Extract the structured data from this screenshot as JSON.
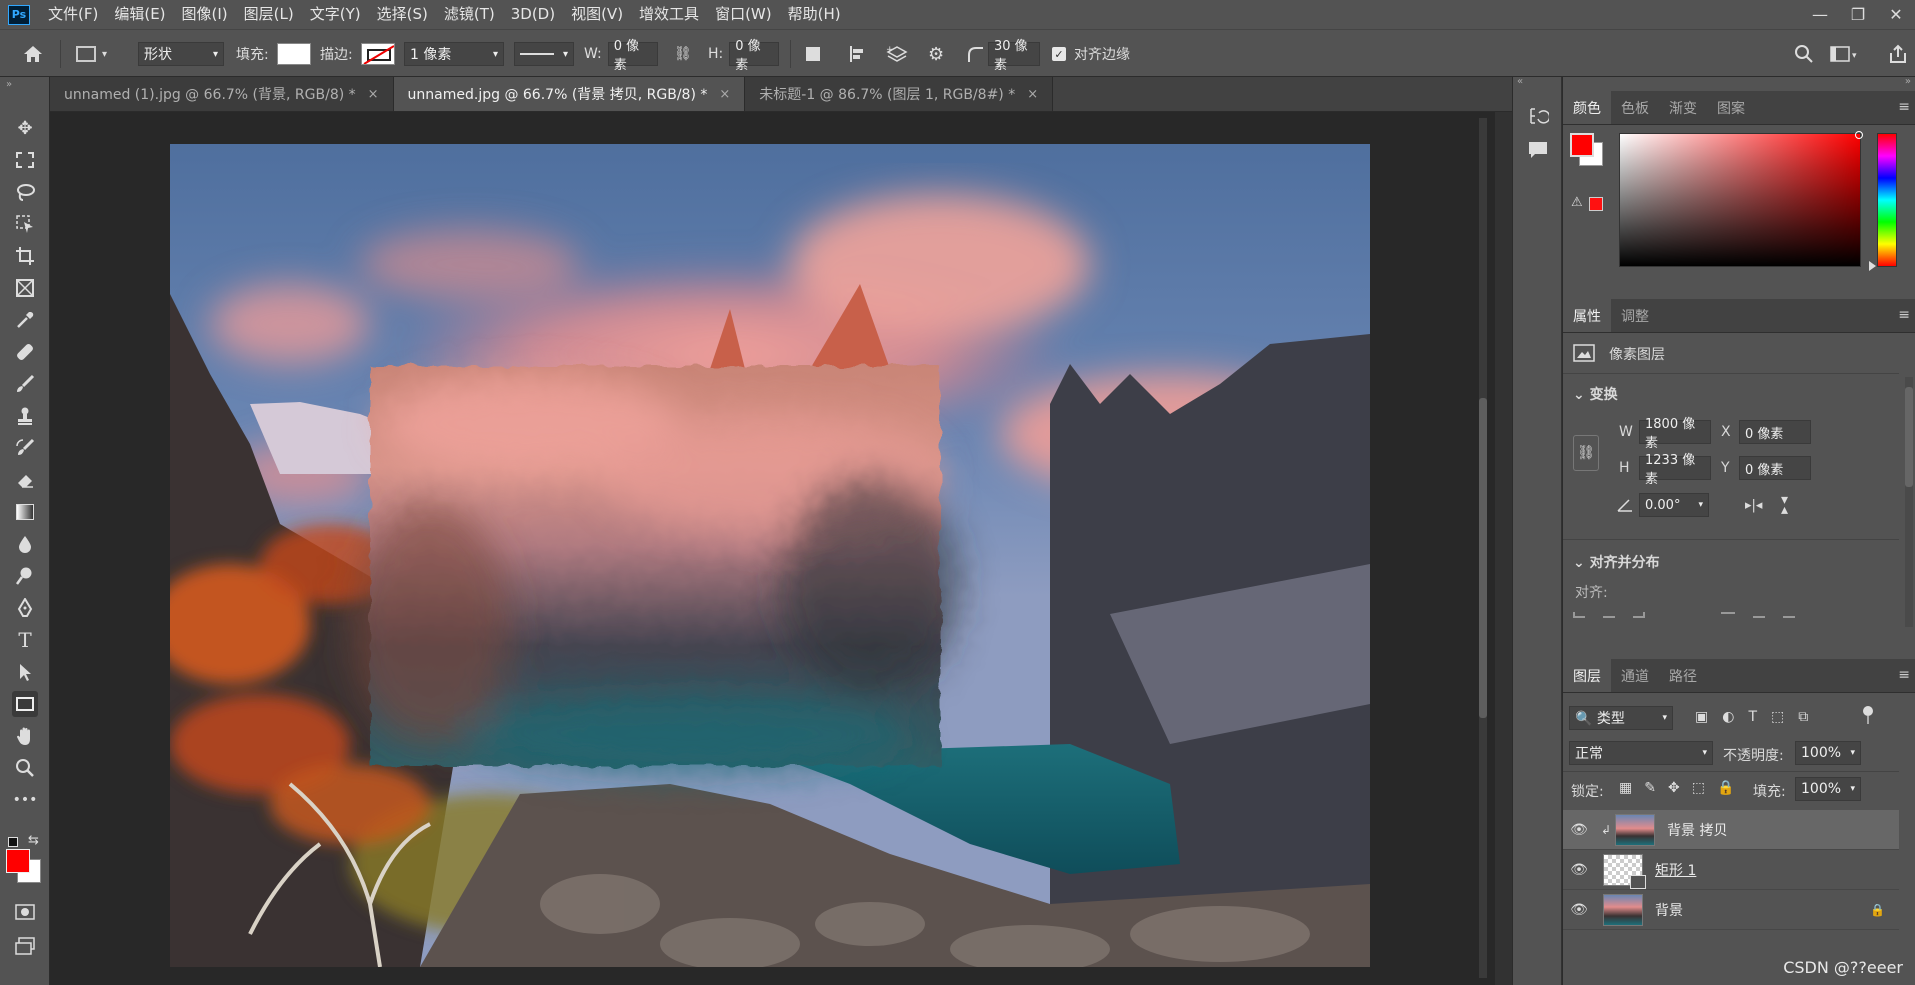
{
  "menubar": {
    "logo": "Ps",
    "items": [
      "文件(F)",
      "编辑(E)",
      "图像(I)",
      "图层(L)",
      "文字(Y)",
      "选择(S)",
      "滤镜(T)",
      "3D(D)",
      "视图(V)",
      "增效工具",
      "窗口(W)",
      "帮助(H)"
    ]
  },
  "options": {
    "mode": "形状",
    "fill_label": "填充:",
    "stroke_label": "描边:",
    "stroke_width": "1 像素",
    "w_label": "W:",
    "w_value": "0 像素",
    "h_label": "H:",
    "h_value": "0 像素",
    "radius_value": "30 像素",
    "align_edges": "对齐边缘"
  },
  "tabs": [
    {
      "label": "unnamed (1).jpg @ 66.7% (背景, RGB/8) *",
      "close": "×"
    },
    {
      "label": "unnamed.jpg @ 66.7% (背景 拷贝, RGB/8) *",
      "close": "×"
    },
    {
      "label": "未标题-1 @ 86.7% (图层 1, RGB/8#) *",
      "close": "×"
    }
  ],
  "color_panel": {
    "tabs": [
      "颜色",
      "色板",
      "渐变",
      "图案"
    ],
    "foreground": "#ff0000",
    "background": "#ffffff"
  },
  "properties": {
    "tabs": [
      "属性",
      "调整"
    ],
    "layer_type": "像素图层",
    "transform_title": "变换",
    "w_label": "W",
    "w_value": "1800 像素",
    "x_label": "X",
    "x_value": "0 像素",
    "h_label": "H",
    "h_value": "1233 像素",
    "y_label": "Y",
    "y_value": "0 像素",
    "angle": "0.00°",
    "align_title": "对齐并分布",
    "align_label": "对齐:"
  },
  "layers": {
    "tabs": [
      "图层",
      "通道",
      "路径"
    ],
    "filter_kind": "类型",
    "blend_mode": "正常",
    "opacity_label": "不透明度:",
    "opacity": "100%",
    "lock_label": "锁定:",
    "fill_label": "填充:",
    "fill": "100%",
    "items": [
      {
        "name": "背景 拷贝"
      },
      {
        "name": "矩形 1"
      },
      {
        "name": "背景"
      }
    ]
  },
  "watermark": "CSDN @??eeer"
}
